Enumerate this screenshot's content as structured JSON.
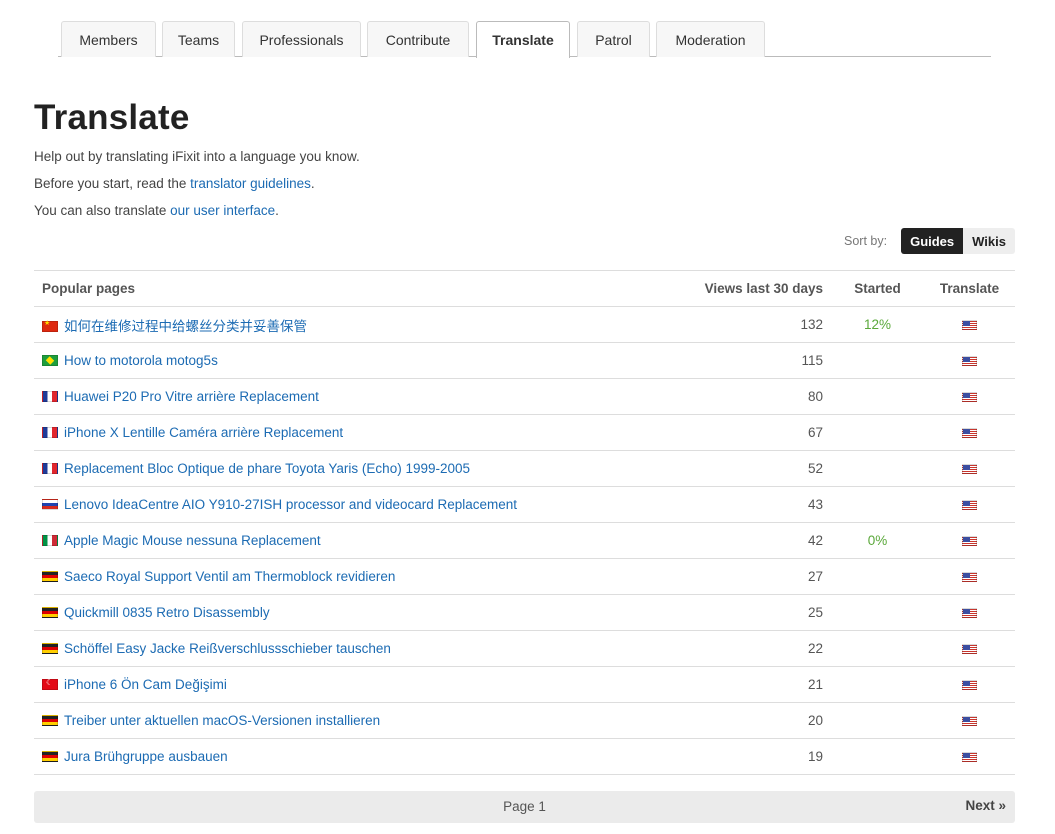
{
  "tabs": [
    "Members",
    "Teams",
    "Professionals",
    "Contribute",
    "Translate",
    "Patrol",
    "Moderation"
  ],
  "active_tab": "Translate",
  "heading": "Translate",
  "intro": {
    "line1": "Help out by translating iFixit into a language you know.",
    "line2_prefix": "Before you start, read the ",
    "line2_link": "translator guidelines",
    "line2_suffix": ".",
    "line3_prefix": "You can also translate ",
    "line3_link": "our user interface",
    "line3_suffix": "."
  },
  "sort": {
    "label": "Sort by:",
    "options": [
      "Guides",
      "Wikis"
    ],
    "selected": "Guides"
  },
  "table": {
    "headers": {
      "page": "Popular pages",
      "views": "Views last 30 days",
      "started": "Started",
      "translate": "Translate"
    },
    "rows": [
      {
        "flag": "cn-flag",
        "title": "如何在维修过程中给螺丝分类并妥善保管",
        "views": "132",
        "started": "12%",
        "translate_flag": "us-flag"
      },
      {
        "flag": "br-flag",
        "title": "How to motorola motog5s",
        "views": "115",
        "started": "",
        "translate_flag": "us-flag"
      },
      {
        "flag": "fr-flag",
        "title": "Huawei P20 Pro Vitre arrière Replacement",
        "views": "80",
        "started": "",
        "translate_flag": "us-flag"
      },
      {
        "flag": "fr-flag",
        "title": "iPhone X Lentille Caméra arrière Replacement",
        "views": "67",
        "started": "",
        "translate_flag": "us-flag"
      },
      {
        "flag": "fr-flag",
        "title": "Replacement Bloc Optique de phare Toyota Yaris (Echo) 1999-2005",
        "views": "52",
        "started": "",
        "translate_flag": "us-flag"
      },
      {
        "flag": "ru-flag",
        "title": "Lenovo IdeaCentre AIO Y910-27ISH processor and videocard Replacement",
        "views": "43",
        "started": "",
        "translate_flag": "us-flag"
      },
      {
        "flag": "it-flag",
        "title": "Apple Magic Mouse nessuna Replacement",
        "views": "42",
        "started": "0%",
        "translate_flag": "us-flag"
      },
      {
        "flag": "de-flag",
        "title": "Saeco Royal Support Ventil am Thermoblock revidieren",
        "views": "27",
        "started": "",
        "translate_flag": "us-flag"
      },
      {
        "flag": "de-flag",
        "title": "Quickmill 0835 Retro Disassembly",
        "views": "25",
        "started": "",
        "translate_flag": "us-flag"
      },
      {
        "flag": "de-flag",
        "title": "Schöffel Easy Jacke Reißverschlussschieber tauschen",
        "views": "22",
        "started": "",
        "translate_flag": "us-flag"
      },
      {
        "flag": "tr-flag",
        "title": "iPhone 6 Ön Cam Değişimi",
        "views": "21",
        "started": "",
        "translate_flag": "us-flag"
      },
      {
        "flag": "de-flag",
        "title": "Treiber unter aktuellen macOS-Versionen installieren",
        "views": "20",
        "started": "",
        "translate_flag": "us-flag"
      },
      {
        "flag": "de-flag",
        "title": "Jura Brühgruppe ausbauen",
        "views": "19",
        "started": "",
        "translate_flag": "us-flag"
      }
    ]
  },
  "pager": {
    "label": "Page 1",
    "next": "Next »"
  },
  "colors": {
    "link": "#1c6bb3",
    "started": "#5aa83a",
    "sort_selected_bg": "#222222"
  }
}
